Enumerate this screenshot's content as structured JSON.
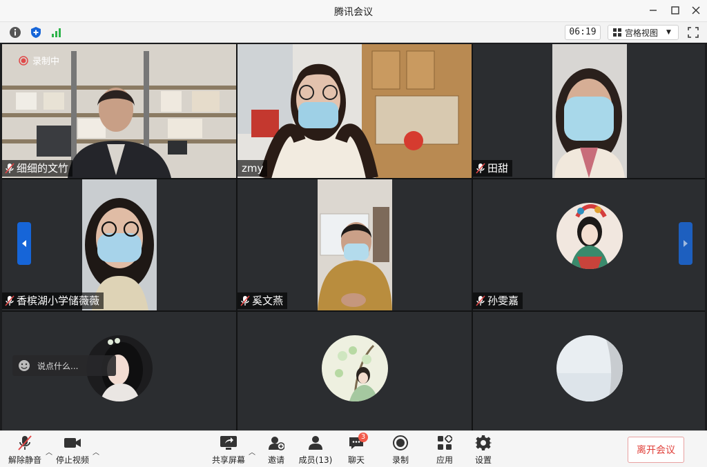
{
  "window": {
    "title": "腾讯会议"
  },
  "toolbar": {
    "timer": "06:19",
    "view_mode": "宫格视图"
  },
  "grid": {
    "recording_label": "录制中",
    "participants": [
      {
        "name": "细细的文竹",
        "muted": true
      },
      {
        "name": "zmy",
        "muted": false
      },
      {
        "name": "田甜",
        "muted": true
      },
      {
        "name": "香槟湖小学储薇薇",
        "muted": true
      },
      {
        "name": "奚文燕",
        "muted": true
      },
      {
        "name": "孙雯嘉",
        "muted": true
      },
      {
        "name": "",
        "muted": true
      },
      {
        "name": "",
        "muted": true
      },
      {
        "name": "",
        "muted": true
      }
    ],
    "chat_placeholder": "说点什么..."
  },
  "bottombar": {
    "unmute": "解除静音",
    "stop_video": "停止视频",
    "share_screen": "共享屏幕",
    "invite": "邀请",
    "members": "成员(13)",
    "chat": "聊天",
    "chat_badge": "3",
    "record": "录制",
    "apps": "应用",
    "settings": "设置",
    "leave": "离开会议"
  },
  "colors": {
    "accent": "#1665d8",
    "leave_red": "#e0403a",
    "badge": "#f25a4a"
  }
}
